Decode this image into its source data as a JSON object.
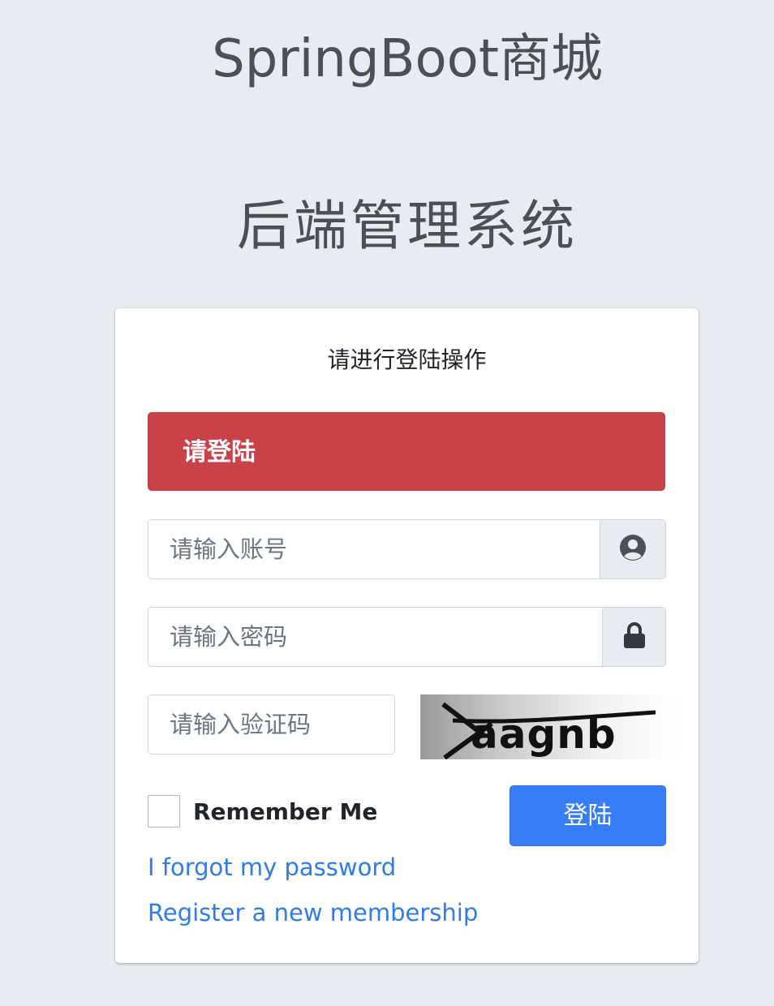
{
  "header": {
    "app_title": "SpringBoot商城",
    "system_title": "后端管理系统"
  },
  "login": {
    "message": "请进行登陆操作",
    "alert_text": "请登陆",
    "account_placeholder": "请输入账号",
    "password_placeholder": "请输入密码",
    "captcha_placeholder": "请输入验证码",
    "captcha_text": "aagnb",
    "remember_label": "Remember Me",
    "login_button": "登陆",
    "forgot_link": "I forgot my password",
    "register_link": "Register a new membership"
  },
  "icons": {
    "account": "user-circle-icon",
    "password": "lock-icon"
  },
  "colors": {
    "alert": "#c9424a",
    "primary": "#377df5",
    "link": "#2f7be8",
    "background": "#e9ecef"
  }
}
